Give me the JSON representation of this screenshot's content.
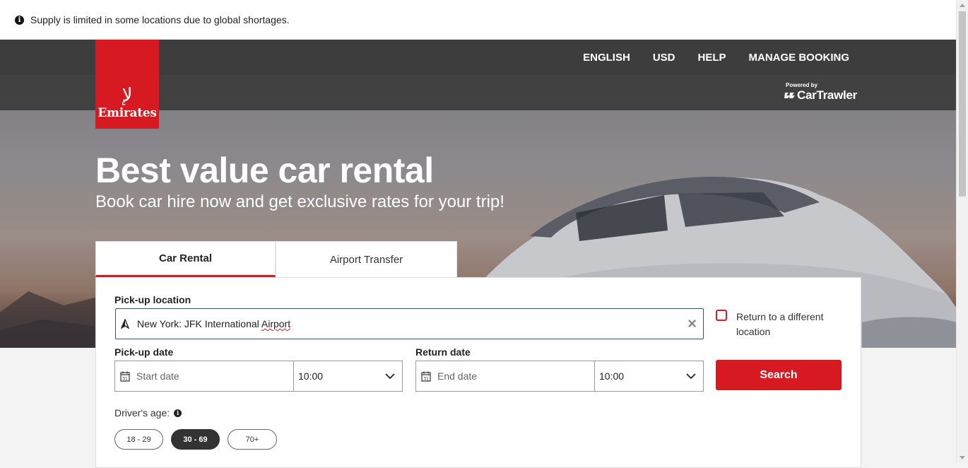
{
  "notice": {
    "text": "Supply is limited in some locations due to global shortages.",
    "icon": "info-icon"
  },
  "topnav": {
    "items": [
      "ENGLISH",
      "USD",
      "HELP",
      "MANAGE BOOKING"
    ]
  },
  "brand": {
    "name": "Emirates",
    "color": "#d71921"
  },
  "powered_by": {
    "label": "Powered by",
    "name": "CarTrawler"
  },
  "hero": {
    "title": "Best value car rental",
    "subtitle": "Book car hire now and get exclusive rates for your trip!"
  },
  "tabs": [
    {
      "label": "Car Rental",
      "active": true
    },
    {
      "label": "Airport Transfer",
      "active": false
    }
  ],
  "form": {
    "pickup_location_label": "Pick-up location",
    "pickup_location_value_prefix": "New York: JFK International ",
    "pickup_location_value_suffix": "Airport",
    "return_different_label": "Return to a different location",
    "return_different_checked": false,
    "pickup_date_label": "Pick-up date",
    "pickup_date_placeholder": "Start date",
    "pickup_time": "10:00",
    "return_date_label": "Return date",
    "return_date_placeholder": "End date",
    "return_time": "10:00",
    "search_label": "Search",
    "driver_age_label": "Driver's age:",
    "age_options": [
      "18 - 29",
      "30 - 69",
      "70+"
    ],
    "age_selected": "30 - 69"
  }
}
